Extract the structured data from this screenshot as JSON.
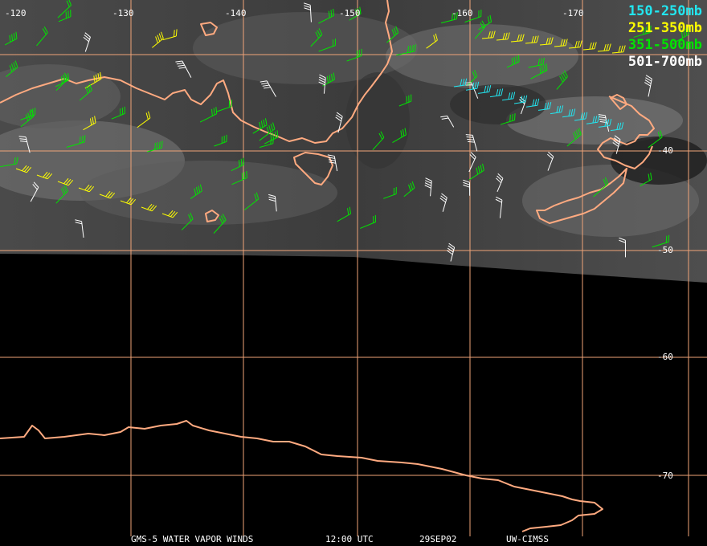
{
  "lon_labels": [
    "-120",
    "-130",
    "-140",
    "-150",
    "-160",
    "-170"
  ],
  "lat_labels": [
    "-40",
    "-50",
    "-60",
    "-70"
  ],
  "legend": [
    {
      "label": "150-250mb",
      "color": "#22e6f0"
    },
    {
      "label": "251-350mb",
      "color": "#ffff00"
    },
    {
      "label": "351-500mb",
      "color": "#00e600"
    },
    {
      "label": "501-700mb",
      "color": "#ffffff"
    }
  ],
  "footer": {
    "satellite": "GMS-5 WATER VAPOR WINDS",
    "time": "12:00 UTC",
    "date": "29SEP02",
    "source": "UW-CIMSS"
  },
  "colors": {
    "grid": "#f0a478",
    "coast": "#ffaa80",
    "background": "#000000"
  }
}
